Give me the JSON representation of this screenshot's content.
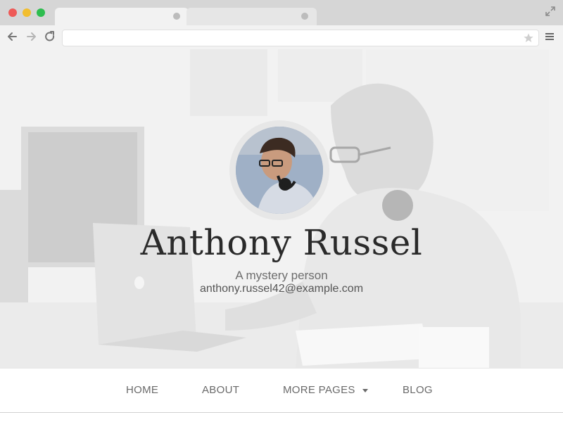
{
  "browser": {
    "tabs": [
      {
        "title": "",
        "active": true
      },
      {
        "title": "",
        "active": false
      }
    ],
    "address": "",
    "icons": [
      "back-icon",
      "forward-icon",
      "reload-icon",
      "star-icon",
      "menu-icon",
      "expand-icon"
    ]
  },
  "hero": {
    "name": "Anthony Russel",
    "tagline": "A mystery person",
    "email": "anthony.russel42@example.com"
  },
  "nav": {
    "items": [
      {
        "label": "HOME"
      },
      {
        "label": "ABOUT"
      },
      {
        "label": "MORE PAGES",
        "dropdown": true
      },
      {
        "label": "BLOG"
      }
    ]
  },
  "colors": {
    "chrome": "#d6d6d6",
    "toolbar": "#f2f2f2",
    "nav_text": "#6a6a6a",
    "name_text": "#2a2a2a"
  }
}
